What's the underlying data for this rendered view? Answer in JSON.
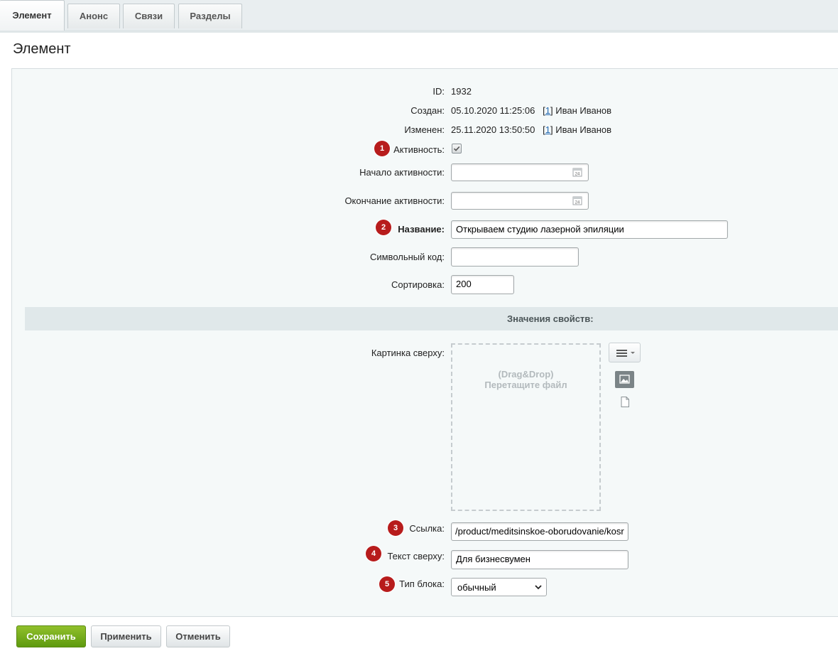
{
  "tabs": [
    {
      "label": "Элемент",
      "active": true
    },
    {
      "label": "Анонс"
    },
    {
      "label": "Связи"
    },
    {
      "label": "Разделы"
    }
  ],
  "page_title": "Элемент",
  "fields": {
    "id": {
      "label": "ID:",
      "value": "1932"
    },
    "created": {
      "label": "Создан:",
      "value": "05.10.2020 11:25:06",
      "user_link": "1",
      "user_name": "Иван Иванов"
    },
    "modified": {
      "label": "Изменен:",
      "value": "25.11.2020 13:50:50",
      "user_link": "1",
      "user_name": "Иван Иванов"
    },
    "active": {
      "label": "Активность:",
      "checked": true,
      "badge": "1"
    },
    "active_from": {
      "label": "Начало активности:",
      "value": ""
    },
    "active_to": {
      "label": "Окончание активности:",
      "value": ""
    },
    "name": {
      "label": "Название:",
      "value": "Открываем студию лазерной эпиляции",
      "badge": "2"
    },
    "code": {
      "label": "Символьный код:",
      "value": ""
    },
    "sort": {
      "label": "Сортировка:",
      "value": "200"
    }
  },
  "properties": {
    "title": "Значения свойств:",
    "picture": {
      "label": "Картинка сверху:",
      "dz_line1": "(Drag&Drop)",
      "dz_line2": "Перетащите файл"
    },
    "link": {
      "label": "Ссылка:",
      "value": "/product/meditsinskoe-oborudovanie/kosr",
      "badge": "3"
    },
    "top_text": {
      "label": "Текст сверху:",
      "value": "Для бизнесвумен",
      "badge": "4"
    },
    "block_type": {
      "label": "Тип блока:",
      "value": "обычный",
      "badge": "5"
    }
  },
  "buttons": {
    "save": "Сохранить",
    "apply": "Применить",
    "cancel": "Отменить"
  },
  "colors": {
    "badge": "#b71c1c",
    "save_button": "#7aae1e",
    "link": "#2067b0"
  }
}
